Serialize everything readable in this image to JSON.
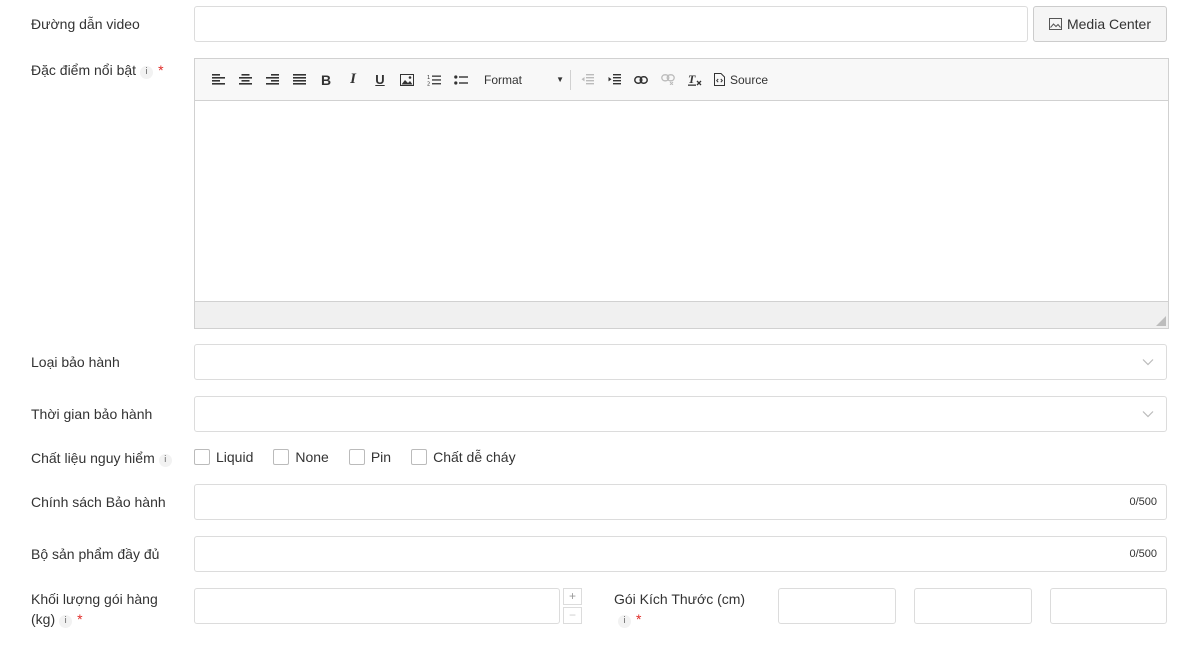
{
  "video": {
    "label": "Đường dẫn video",
    "value": "",
    "media_button": "Media Center"
  },
  "highlights": {
    "label": "Đặc điểm nổi bật",
    "info": "i",
    "required": "*",
    "format_label": "Format",
    "source_label": "Source"
  },
  "warranty_type": {
    "label": "Loại bảo hành",
    "value": ""
  },
  "warranty_time": {
    "label": "Thời gian bảo hành",
    "value": ""
  },
  "hazmat": {
    "label": "Chất liệu nguy hiểm",
    "info": "i",
    "options": [
      "Liquid",
      "None",
      "Pin",
      "Chất dễ cháy"
    ]
  },
  "warranty_policy": {
    "label": "Chính sách Bảo hành",
    "value": "",
    "counter": "0/500"
  },
  "full_set": {
    "label": "Bộ sản phẩm đầy đủ",
    "value": "",
    "counter": "0/500"
  },
  "weight": {
    "label_line1": "Khối lượng gói hàng",
    "label_line2": "(kg)",
    "info": "i",
    "required": "*",
    "value": "",
    "plus": "+",
    "minus": "−"
  },
  "dimensions": {
    "label": "Gói Kích Thước (cm)",
    "info": "i",
    "required": "*",
    "length": "",
    "width": "",
    "height": ""
  }
}
